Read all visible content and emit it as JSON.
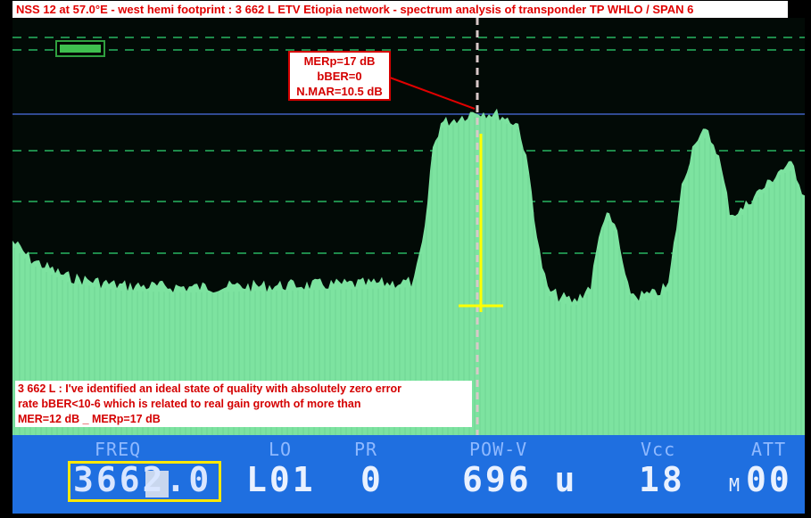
{
  "title": "NSS 12 at 57.0°E - west hemi footprint : 3 662 L ETV Etiopia network - spectrum analysis of transponder TP WHLO / SPAN 6",
  "callout": {
    "lines": [
      "MERp=17 dB",
      "bBER=0",
      "N.MAR=10.5 dB"
    ]
  },
  "note": {
    "lines": [
      "3 662 L : I've identified an ideal state of quality with absolutely zero error",
      "rate bBER<10-6 which is related to real gain growth of more than",
      "MER=12 dB _ MERp=17 dB"
    ]
  },
  "battery": {
    "level": 1.0
  },
  "meter": {
    "freq": {
      "label": "FREQ",
      "value": "3662.0"
    },
    "lo": {
      "label": "LO",
      "value": "L01"
    },
    "pr": {
      "label": "PR",
      "value": "0"
    },
    "pow": {
      "label": "POW-V",
      "value": "696 u"
    },
    "vcc": {
      "label": "Vcc",
      "value": "18"
    },
    "att": {
      "label": "ATT",
      "prefix": "M",
      "value": "00"
    }
  },
  "colors": {
    "trace": "#7de3a0",
    "grid": "#1e8a4a",
    "reference_line": "#3f5fbf",
    "marker": "#ffff00",
    "callout_border": "#d40000",
    "panel": "#1f6fe0"
  }
}
